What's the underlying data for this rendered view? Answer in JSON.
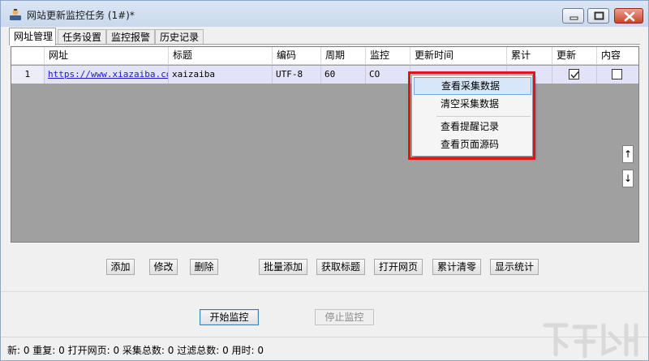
{
  "window": {
    "title": "网站更新监控任务  (1#)*"
  },
  "tabs": [
    {
      "label": "网址管理",
      "active": true
    },
    {
      "label": "任务设置",
      "active": false
    },
    {
      "label": "监控报警",
      "active": false
    },
    {
      "label": "历史记录",
      "active": false
    }
  ],
  "grid": {
    "columns": [
      "网址",
      "标题",
      "编码",
      "周期",
      "监控",
      "更新时间",
      "累计",
      "更新",
      "内容"
    ],
    "rows": [
      {
        "index": "1",
        "url": "https://www.xiazaiba.com",
        "title": "xaizaiba",
        "encoding": "UTF-8",
        "period": "60",
        "monitor": "CO",
        "update_time": "",
        "total": "",
        "update_checked": true,
        "content_checked": false
      }
    ],
    "scroll_up": "↑",
    "scroll_down": "↓"
  },
  "context_menu": {
    "items": [
      {
        "label": "查看采集数据",
        "selected": true
      },
      {
        "label": "清空采集数据",
        "selected": false
      },
      {
        "label": "查看提醒记录",
        "selected": false
      },
      {
        "label": "查看页面源码",
        "selected": false
      }
    ],
    "highlight_color": "#e2141b"
  },
  "toolbar": {
    "add": "添加",
    "edit": "修改",
    "delete": "删除",
    "batch_add": "批量添加",
    "get_title": "获取标题",
    "open_page": "打开网页",
    "reset_total": "累计清零",
    "show_stats": "显示统计"
  },
  "actions": {
    "start": "开始监控",
    "stop": "停止监控"
  },
  "status": {
    "text": "新: 0  重复: 0  打开网页: 0  采集总数: 0  过滤总数: 0  用时: 0"
  },
  "icons": {
    "app": "monitor-app-icon",
    "minimize": "minimize-icon",
    "maximize": "maximize-icon",
    "close": "close-icon"
  }
}
